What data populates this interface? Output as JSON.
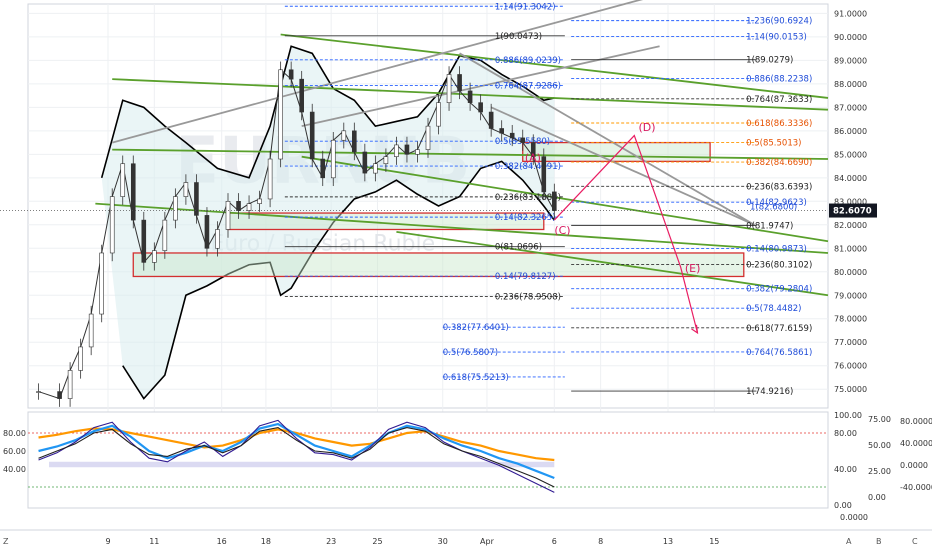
{
  "chart_data": {
    "type": "line",
    "watermark_text": "EURRUB",
    "watermark_subtitle": "Euro / Russian Ruble",
    "price_axis": {
      "ylim": [
        74.2,
        91.4
      ],
      "ticks": [
        91.0,
        90.0,
        89.0,
        88.0,
        87.0,
        86.0,
        85.0,
        84.0,
        83.0,
        82.0,
        81.0,
        80.0,
        79.0,
        78.0,
        77.0,
        76.0,
        75.0
      ],
      "tick_labels": [
        "91.0000",
        "90.0000",
        "89.0000",
        "88.0000",
        "87.0000",
        "86.0000",
        "85.0000",
        "84.0000",
        "83.0000",
        "82.0000",
        "81.0000",
        "80.0000",
        "79.0000",
        "78.0000",
        "77.0000",
        "76.0000",
        "75.0000"
      ],
      "current_price": 82.607,
      "current_price_label": "82.6070",
      "current_price_color": "#131722"
    },
    "time_axis": {
      "x_min": 0,
      "x_max": 38,
      "ticks": [
        {
          "x": 3.8,
          "label": "9"
        },
        {
          "x": 6.0,
          "label": "11"
        },
        {
          "x": 9.2,
          "label": "16"
        },
        {
          "x": 11.3,
          "label": "18"
        },
        {
          "x": 14.4,
          "label": "23"
        },
        {
          "x": 16.6,
          "label": "25"
        },
        {
          "x": 19.7,
          "label": "30"
        },
        {
          "x": 21.8,
          "label": "Apr"
        },
        {
          "x": 25.0,
          "label": "6"
        },
        {
          "x": 27.2,
          "label": "8"
        },
        {
          "x": 30.4,
          "label": "13"
        },
        {
          "x": 32.6,
          "label": "15"
        }
      ]
    },
    "price_series": [
      {
        "x": 0.5,
        "y": 74.9
      },
      {
        "x": 1.5,
        "y": 74.6
      },
      {
        "x": 2.0,
        "y": 75.8
      },
      {
        "x": 2.5,
        "y": 76.8
      },
      {
        "x": 3.0,
        "y": 78.2
      },
      {
        "x": 3.5,
        "y": 80.8
      },
      {
        "x": 4.0,
        "y": 83.2
      },
      {
        "x": 4.5,
        "y": 84.6
      },
      {
        "x": 5.0,
        "y": 82.2
      },
      {
        "x": 5.5,
        "y": 80.4
      },
      {
        "x": 6.0,
        "y": 80.9
      },
      {
        "x": 6.5,
        "y": 82.2
      },
      {
        "x": 7.0,
        "y": 83.2
      },
      {
        "x": 7.5,
        "y": 83.8
      },
      {
        "x": 8.0,
        "y": 82.4
      },
      {
        "x": 8.5,
        "y": 81.0
      },
      {
        "x": 9.0,
        "y": 81.8
      },
      {
        "x": 9.5,
        "y": 83.0
      },
      {
        "x": 10.0,
        "y": 82.6
      },
      {
        "x": 10.5,
        "y": 82.9
      },
      {
        "x": 11.0,
        "y": 83.1
      },
      {
        "x": 11.5,
        "y": 84.8
      },
      {
        "x": 12.0,
        "y": 88.6
      },
      {
        "x": 12.5,
        "y": 88.2
      },
      {
        "x": 13.0,
        "y": 86.8
      },
      {
        "x": 13.5,
        "y": 84.8
      },
      {
        "x": 14.0,
        "y": 84.0
      },
      {
        "x": 14.5,
        "y": 85.6
      },
      {
        "x": 15.0,
        "y": 86.0
      },
      {
        "x": 15.5,
        "y": 85.1
      },
      {
        "x": 16.0,
        "y": 84.2
      },
      {
        "x": 16.5,
        "y": 84.6
      },
      {
        "x": 17.0,
        "y": 84.9
      },
      {
        "x": 17.5,
        "y": 85.4
      },
      {
        "x": 18.0,
        "y": 85.0
      },
      {
        "x": 18.5,
        "y": 85.2
      },
      {
        "x": 19.0,
        "y": 86.2
      },
      {
        "x": 19.5,
        "y": 87.2
      },
      {
        "x": 20.0,
        "y": 88.4
      },
      {
        "x": 20.5,
        "y": 87.7
      },
      {
        "x": 21.0,
        "y": 87.2
      },
      {
        "x": 21.5,
        "y": 86.8
      },
      {
        "x": 22.0,
        "y": 86.1
      },
      {
        "x": 22.5,
        "y": 85.9
      },
      {
        "x": 23.0,
        "y": 85.7
      },
      {
        "x": 23.5,
        "y": 85.5
      },
      {
        "x": 24.0,
        "y": 84.9
      },
      {
        "x": 24.5,
        "y": 83.4
      },
      {
        "x": 25.0,
        "y": 82.6
      }
    ],
    "bb_upper": [
      {
        "x": 3.5,
        "y": 84.0
      },
      {
        "x": 4.5,
        "y": 87.3
      },
      {
        "x": 5.5,
        "y": 87.0
      },
      {
        "x": 6.5,
        "y": 86.2
      },
      {
        "x": 7.5,
        "y": 85.5
      },
      {
        "x": 9.0,
        "y": 84.4
      },
      {
        "x": 10.5,
        "y": 84.0
      },
      {
        "x": 11.5,
        "y": 86.2
      },
      {
        "x": 12.5,
        "y": 89.6
      },
      {
        "x": 13.5,
        "y": 89.3
      },
      {
        "x": 14.5,
        "y": 87.8
      },
      {
        "x": 15.5,
        "y": 87.3
      },
      {
        "x": 16.5,
        "y": 86.2
      },
      {
        "x": 17.5,
        "y": 86.4
      },
      {
        "x": 18.5,
        "y": 86.6
      },
      {
        "x": 19.5,
        "y": 87.6
      },
      {
        "x": 20.5,
        "y": 89.2
      },
      {
        "x": 21.5,
        "y": 89.0
      },
      {
        "x": 22.5,
        "y": 88.4
      },
      {
        "x": 23.5,
        "y": 87.9
      },
      {
        "x": 24.5,
        "y": 87.3
      },
      {
        "x": 25.0,
        "y": 87.4
      }
    ],
    "bb_lower": [
      {
        "x": 4.5,
        "y": 76.0
      },
      {
        "x": 5.5,
        "y": 74.6
      },
      {
        "x": 6.5,
        "y": 75.6
      },
      {
        "x": 7.5,
        "y": 79.0
      },
      {
        "x": 8.5,
        "y": 79.4
      },
      {
        "x": 9.5,
        "y": 79.9
      },
      {
        "x": 10.5,
        "y": 80.3
      },
      {
        "x": 11.5,
        "y": 80.4
      },
      {
        "x": 12.0,
        "y": 79.0
      },
      {
        "x": 12.5,
        "y": 79.3
      },
      {
        "x": 13.5,
        "y": 80.8
      },
      {
        "x": 14.5,
        "y": 82.1
      },
      {
        "x": 15.5,
        "y": 83.1
      },
      {
        "x": 16.5,
        "y": 83.4
      },
      {
        "x": 17.5,
        "y": 83.9
      },
      {
        "x": 18.5,
        "y": 83.3
      },
      {
        "x": 19.5,
        "y": 82.8
      },
      {
        "x": 20.5,
        "y": 83.2
      },
      {
        "x": 21.5,
        "y": 84.4
      },
      {
        "x": 22.5,
        "y": 84.7
      },
      {
        "x": 23.5,
        "y": 83.9
      },
      {
        "x": 24.5,
        "y": 82.8
      },
      {
        "x": 25.0,
        "y": 82.2
      }
    ],
    "fib_levels": [
      {
        "label": "1.14(91.3042)",
        "y": 91.3042,
        "x0": 12.2,
        "x1": 25.5,
        "color": "#2962ff",
        "dash": true
      },
      {
        "label": "1(90.0473)",
        "y": 90.0473,
        "x0": 12.2,
        "x1": 25.5,
        "color": "#333333",
        "dash": false
      },
      {
        "label": "0.886(89.0239)",
        "y": 89.0239,
        "x0": 12.2,
        "x1": 25.5,
        "color": "#2962ff",
        "dash": true
      },
      {
        "label": "0.764(87.9286)",
        "y": 87.9286,
        "x0": 12.2,
        "x1": 25.5,
        "color": "#2962ff",
        "dash": true
      },
      {
        "label": "0.5(85.5580)",
        "y": 85.558,
        "x0": 12.2,
        "x1": 25.5,
        "color": "#2962ff",
        "dash": true
      },
      {
        "label": "0.382(84.4991)",
        "y": 84.4991,
        "x0": 12.2,
        "x1": 25.5,
        "color": "#2962ff",
        "dash": true
      },
      {
        "label": "0.236(83.1883)",
        "y": 83.1883,
        "x0": 12.2,
        "x1": 25.5,
        "color": "#333333",
        "dash": true
      },
      {
        "label": "0.14(82.3265)",
        "y": 82.3265,
        "x0": 12.2,
        "x1": 25.5,
        "color": "#2962ff",
        "dash": true
      },
      {
        "label": "0(81.0696)",
        "y": 81.0696,
        "x0": 12.2,
        "x1": 25.5,
        "color": "#333333",
        "dash": false
      },
      {
        "label": "0.14(79.8127)",
        "y": 79.8127,
        "x0": 12.2,
        "x1": 25.5,
        "color": "#2962ff",
        "dash": true
      },
      {
        "label": "0.236(78.9508)",
        "y": 78.9508,
        "x0": 12.2,
        "x1": 25.5,
        "color": "#333333",
        "dash": true
      },
      {
        "label": "0.382(77.6401)",
        "y": 77.6401,
        "x0": 19.7,
        "x1": 25.5,
        "color": "#2962ff",
        "dash": true
      },
      {
        "label": "0.5(76.5807)",
        "y": 76.5807,
        "x0": 19.7,
        "x1": 25.5,
        "color": "#2962ff",
        "dash": true
      },
      {
        "label": "0.618(75.5213)",
        "y": 75.5213,
        "x0": 19.7,
        "x1": 25.5,
        "color": "#2962ff",
        "dash": true
      },
      {
        "label": "1.236(90.6924)",
        "y": 90.6924,
        "x0": 25.8,
        "x1": 34.6,
        "color": "#2962ff",
        "dash": true
      },
      {
        "label": "1.14(90.0153)",
        "y": 90.0153,
        "x0": 25.8,
        "x1": 34.6,
        "color": "#2962ff",
        "dash": true
      },
      {
        "label": "1(89.0279)",
        "y": 89.0279,
        "x0": 25.8,
        "x1": 34.6,
        "color": "#333333",
        "dash": false
      },
      {
        "label": "0.886(88.2238)",
        "y": 88.2238,
        "x0": 25.8,
        "x1": 34.6,
        "color": "#2962ff",
        "dash": true
      },
      {
        "label": "0.764(87.3633)",
        "y": 87.3633,
        "x0": 25.8,
        "x1": 34.6,
        "color": "#333333",
        "dash": true
      },
      {
        "label": "0.618(86.3336)",
        "y": 86.3336,
        "x0": 25.8,
        "x1": 34.6,
        "color": "#ff9800",
        "dash": true
      },
      {
        "label": "0.5(85.5013)",
        "y": 85.5013,
        "x0": 25.8,
        "x1": 34.6,
        "color": "#ff9800",
        "dash": true
      },
      {
        "label": "0.382(84.6690)",
        "y": 84.669,
        "x0": 25.8,
        "x1": 34.6,
        "color": "#ff9800",
        "dash": true
      },
      {
        "label": "0.236(83.6393)",
        "y": 83.6393,
        "x0": 25.8,
        "x1": 34.6,
        "color": "#333333",
        "dash": true
      },
      {
        "label": "0.14(82.9623)",
        "y": 82.9623,
        "x0": 25.8,
        "x1": 34.6,
        "color": "#2962ff",
        "dash": true
      },
      {
        "label": "0(81.9747)",
        "y": 81.9747,
        "x0": 25.8,
        "x1": 34.6,
        "color": "#333333",
        "dash": false
      },
      {
        "label": "0.14(80.9873)",
        "y": 80.9873,
        "x0": 25.8,
        "x1": 34.6,
        "color": "#2962ff",
        "dash": true
      },
      {
        "label": "0.236(80.3102)",
        "y": 80.3102,
        "x0": 25.8,
        "x1": 34.6,
        "color": "#333333",
        "dash": true
      },
      {
        "label": "0.382(79.2804)",
        "y": 79.2804,
        "x0": 25.8,
        "x1": 34.6,
        "color": "#2962ff",
        "dash": true
      },
      {
        "label": "0.5(78.4482)",
        "y": 78.4482,
        "x0": 25.8,
        "x1": 34.6,
        "color": "#2962ff",
        "dash": true
      },
      {
        "label": "0.618(77.6159)",
        "y": 77.6159,
        "x0": 25.8,
        "x1": 34.6,
        "color": "#333333",
        "dash": true
      },
      {
        "label": "0.764(76.5861)",
        "y": 76.5861,
        "x0": 25.8,
        "x1": 34.6,
        "color": "#2962ff",
        "dash": true
      },
      {
        "label": "1(74.9216)",
        "y": 74.9216,
        "x0": 25.8,
        "x1": 34.6,
        "color": "#333333",
        "dash": false
      }
    ],
    "price_label_current_left": "1(82.6800)",
    "channels": [
      {
        "color": "#5aa02c",
        "x0": 4.0,
        "y0": 88.2,
        "x1": 38.0,
        "y1": 86.9
      },
      {
        "color": "#5aa02c",
        "x0": 12.0,
        "y0": 90.1,
        "x1": 38.0,
        "y1": 87.4
      },
      {
        "color": "#5aa02c",
        "x0": 4.0,
        "y0": 85.2,
        "x1": 38.0,
        "y1": 84.8
      },
      {
        "color": "#5aa02c",
        "x0": 3.2,
        "y0": 82.9,
        "x1": 38.0,
        "y1": 80.8
      },
      {
        "color": "#5aa02c",
        "x0": 13.0,
        "y0": 84.9,
        "x1": 38.0,
        "y1": 81.3
      },
      {
        "color": "#5aa02c",
        "x0": 17.5,
        "y0": 81.7,
        "x1": 38.0,
        "y1": 79.0
      },
      {
        "color": "#999999",
        "x0": 4.0,
        "y0": 85.5,
        "x1": 30.0,
        "y1": 91.8
      },
      {
        "color": "#999999",
        "x0": 13.0,
        "y0": 86.2,
        "x1": 30.0,
        "y1": 89.6
      },
      {
        "color": "#999999",
        "x0": 20.5,
        "y0": 89.3,
        "x1": 34.5,
        "y1": 82.0
      },
      {
        "color": "#999999",
        "x0": 22.0,
        "y0": 87.0,
        "x1": 34.5,
        "y1": 82.0
      }
    ],
    "zones": [
      {
        "x0": 9.5,
        "x1": 24.5,
        "y0": 82.5,
        "y1": 81.8,
        "label": ""
      },
      {
        "x0": 5.0,
        "x1": 34.0,
        "y0": 80.8,
        "y1": 79.8,
        "label": ""
      },
      {
        "x0": 23.5,
        "x1": 32.4,
        "y0": 85.5,
        "y1": 84.7,
        "label": ""
      }
    ],
    "wave_labels": [
      {
        "x": 23.6,
        "y": 84.7,
        "text": "(A)",
        "color": "#d81b60"
      },
      {
        "x": 25.0,
        "y": 81.6,
        "text": "(C)",
        "color": "#d81b60"
      },
      {
        "x": 29.0,
        "y": 86.0,
        "text": "(D)",
        "color": "#d81b60"
      },
      {
        "x": 31.2,
        "y": 80.0,
        "text": "(E)",
        "color": "#d81b60"
      }
    ],
    "wave_path": [
      {
        "x": 25.0,
        "y": 82.2
      },
      {
        "x": 28.8,
        "y": 85.8
      },
      {
        "x": 31.0,
        "y": 80.2
      },
      {
        "x": 31.8,
        "y": 77.4
      }
    ],
    "oscillator": {
      "ylim": [
        0,
        100
      ],
      "ticks_left": [
        {
          "v": 80,
          "label": "80.00"
        },
        {
          "v": 60,
          "label": "60.00"
        },
        {
          "v": 40,
          "label": "40.00"
        }
      ],
      "ticks_mid": [
        {
          "v": 100,
          "label": "100.00"
        },
        {
          "v": 80,
          "label": "80.00"
        },
        {
          "v": 40,
          "label": "40.00"
        },
        {
          "v": 0,
          "label": "0.00"
        }
      ],
      "ticks_right_a": [
        {
          "v": 75,
          "label": "75.00"
        },
        {
          "v": 50,
          "label": "50.00"
        },
        {
          "v": 25,
          "label": "25.00"
        },
        {
          "v": 0,
          "label": "0.00"
        }
      ],
      "ticks_right_b": [
        {
          "v": 80000,
          "label": "80.0000"
        },
        {
          "v": 40000,
          "label": "40.0000"
        },
        {
          "v": 0,
          "label": "0.0000"
        },
        {
          "v": -40000,
          "label": "-40.0000"
        }
      ],
      "series": [
        {
          "name": "",
          "color": "#ff9800",
          "values": [
            75,
            78,
            82,
            85,
            84,
            80,
            76,
            72,
            68,
            64,
            66,
            72,
            80,
            84,
            80,
            74,
            70,
            66,
            68,
            74,
            80,
            82,
            76,
            70,
            66,
            60,
            56,
            52,
            50
          ]
        },
        {
          "name": "",
          "color": "#2196f3",
          "values": [
            60,
            65,
            72,
            82,
            88,
            76,
            60,
            52,
            58,
            66,
            60,
            70,
            85,
            90,
            78,
            66,
            60,
            54,
            66,
            80,
            88,
            84,
            74,
            66,
            60,
            52,
            46,
            38,
            30
          ]
        },
        {
          "name": "",
          "color": "#311b92",
          "values": [
            50,
            58,
            70,
            86,
            92,
            70,
            52,
            48,
            60,
            70,
            54,
            66,
            88,
            94,
            74,
            58,
            56,
            50,
            64,
            84,
            92,
            86,
            70,
            60,
            52,
            44,
            34,
            24,
            14
          ]
        },
        {
          "name": "",
          "color": "#212121",
          "values": [
            52,
            60,
            68,
            80,
            84,
            68,
            56,
            54,
            62,
            66,
            58,
            66,
            82,
            86,
            72,
            60,
            58,
            52,
            62,
            80,
            86,
            82,
            68,
            60,
            54,
            46,
            38,
            30,
            20
          ]
        }
      ],
      "levels": [
        {
          "v": 80,
          "color": "#e53935"
        },
        {
          "v": 20,
          "color": "#43a047"
        }
      ]
    },
    "bottom_controls": [
      "Z",
      "A",
      "B",
      "C"
    ]
  }
}
